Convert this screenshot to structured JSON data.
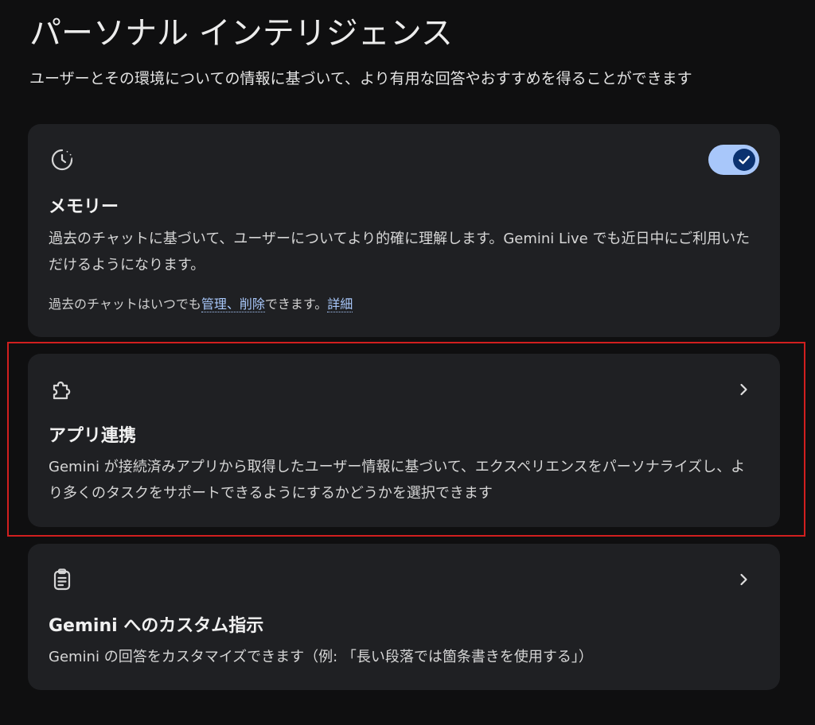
{
  "header": {
    "title": "パーソナル インテリジェンス",
    "subtitle": "ユーザーとその環境についての情報に基づいて、より有用な回答やおすすめを得ることができます"
  },
  "cards": {
    "memory": {
      "icon": "history-clock-icon",
      "title": "メモリー",
      "description": "過去のチャットに基づいて、ユーザーについてより的確に理解します。Gemini Live でも近日中にご利用いただけるようになります。",
      "toggle_on": true,
      "footer": {
        "prefix": "過去のチャットはいつでも",
        "manage_link": "管理、削除",
        "middle": "できます。",
        "details_link": "詳細"
      }
    },
    "apps": {
      "icon": "puzzle-piece-icon",
      "title": "アプリ連携",
      "description": "Gemini が接続済みアプリから取得したユーザー情報に基づいて、エクスペリエンスをパーソナライズし、より多くのタスクをサポートできるようにするかどうかを選択できます"
    },
    "custom": {
      "icon": "clipboard-list-icon",
      "title": "Gemini へのカスタム指示",
      "description": "Gemini の回答をカスタマイズできます（例: 「長い段落では箇条書きを使用する」）"
    }
  },
  "colors": {
    "background": "#0f0f10",
    "card": "#1f2023",
    "link": "#a8c7fa",
    "toggle_track": "#a8c7fa",
    "toggle_knob": "#0b3270",
    "highlight": "#d11f1f"
  }
}
